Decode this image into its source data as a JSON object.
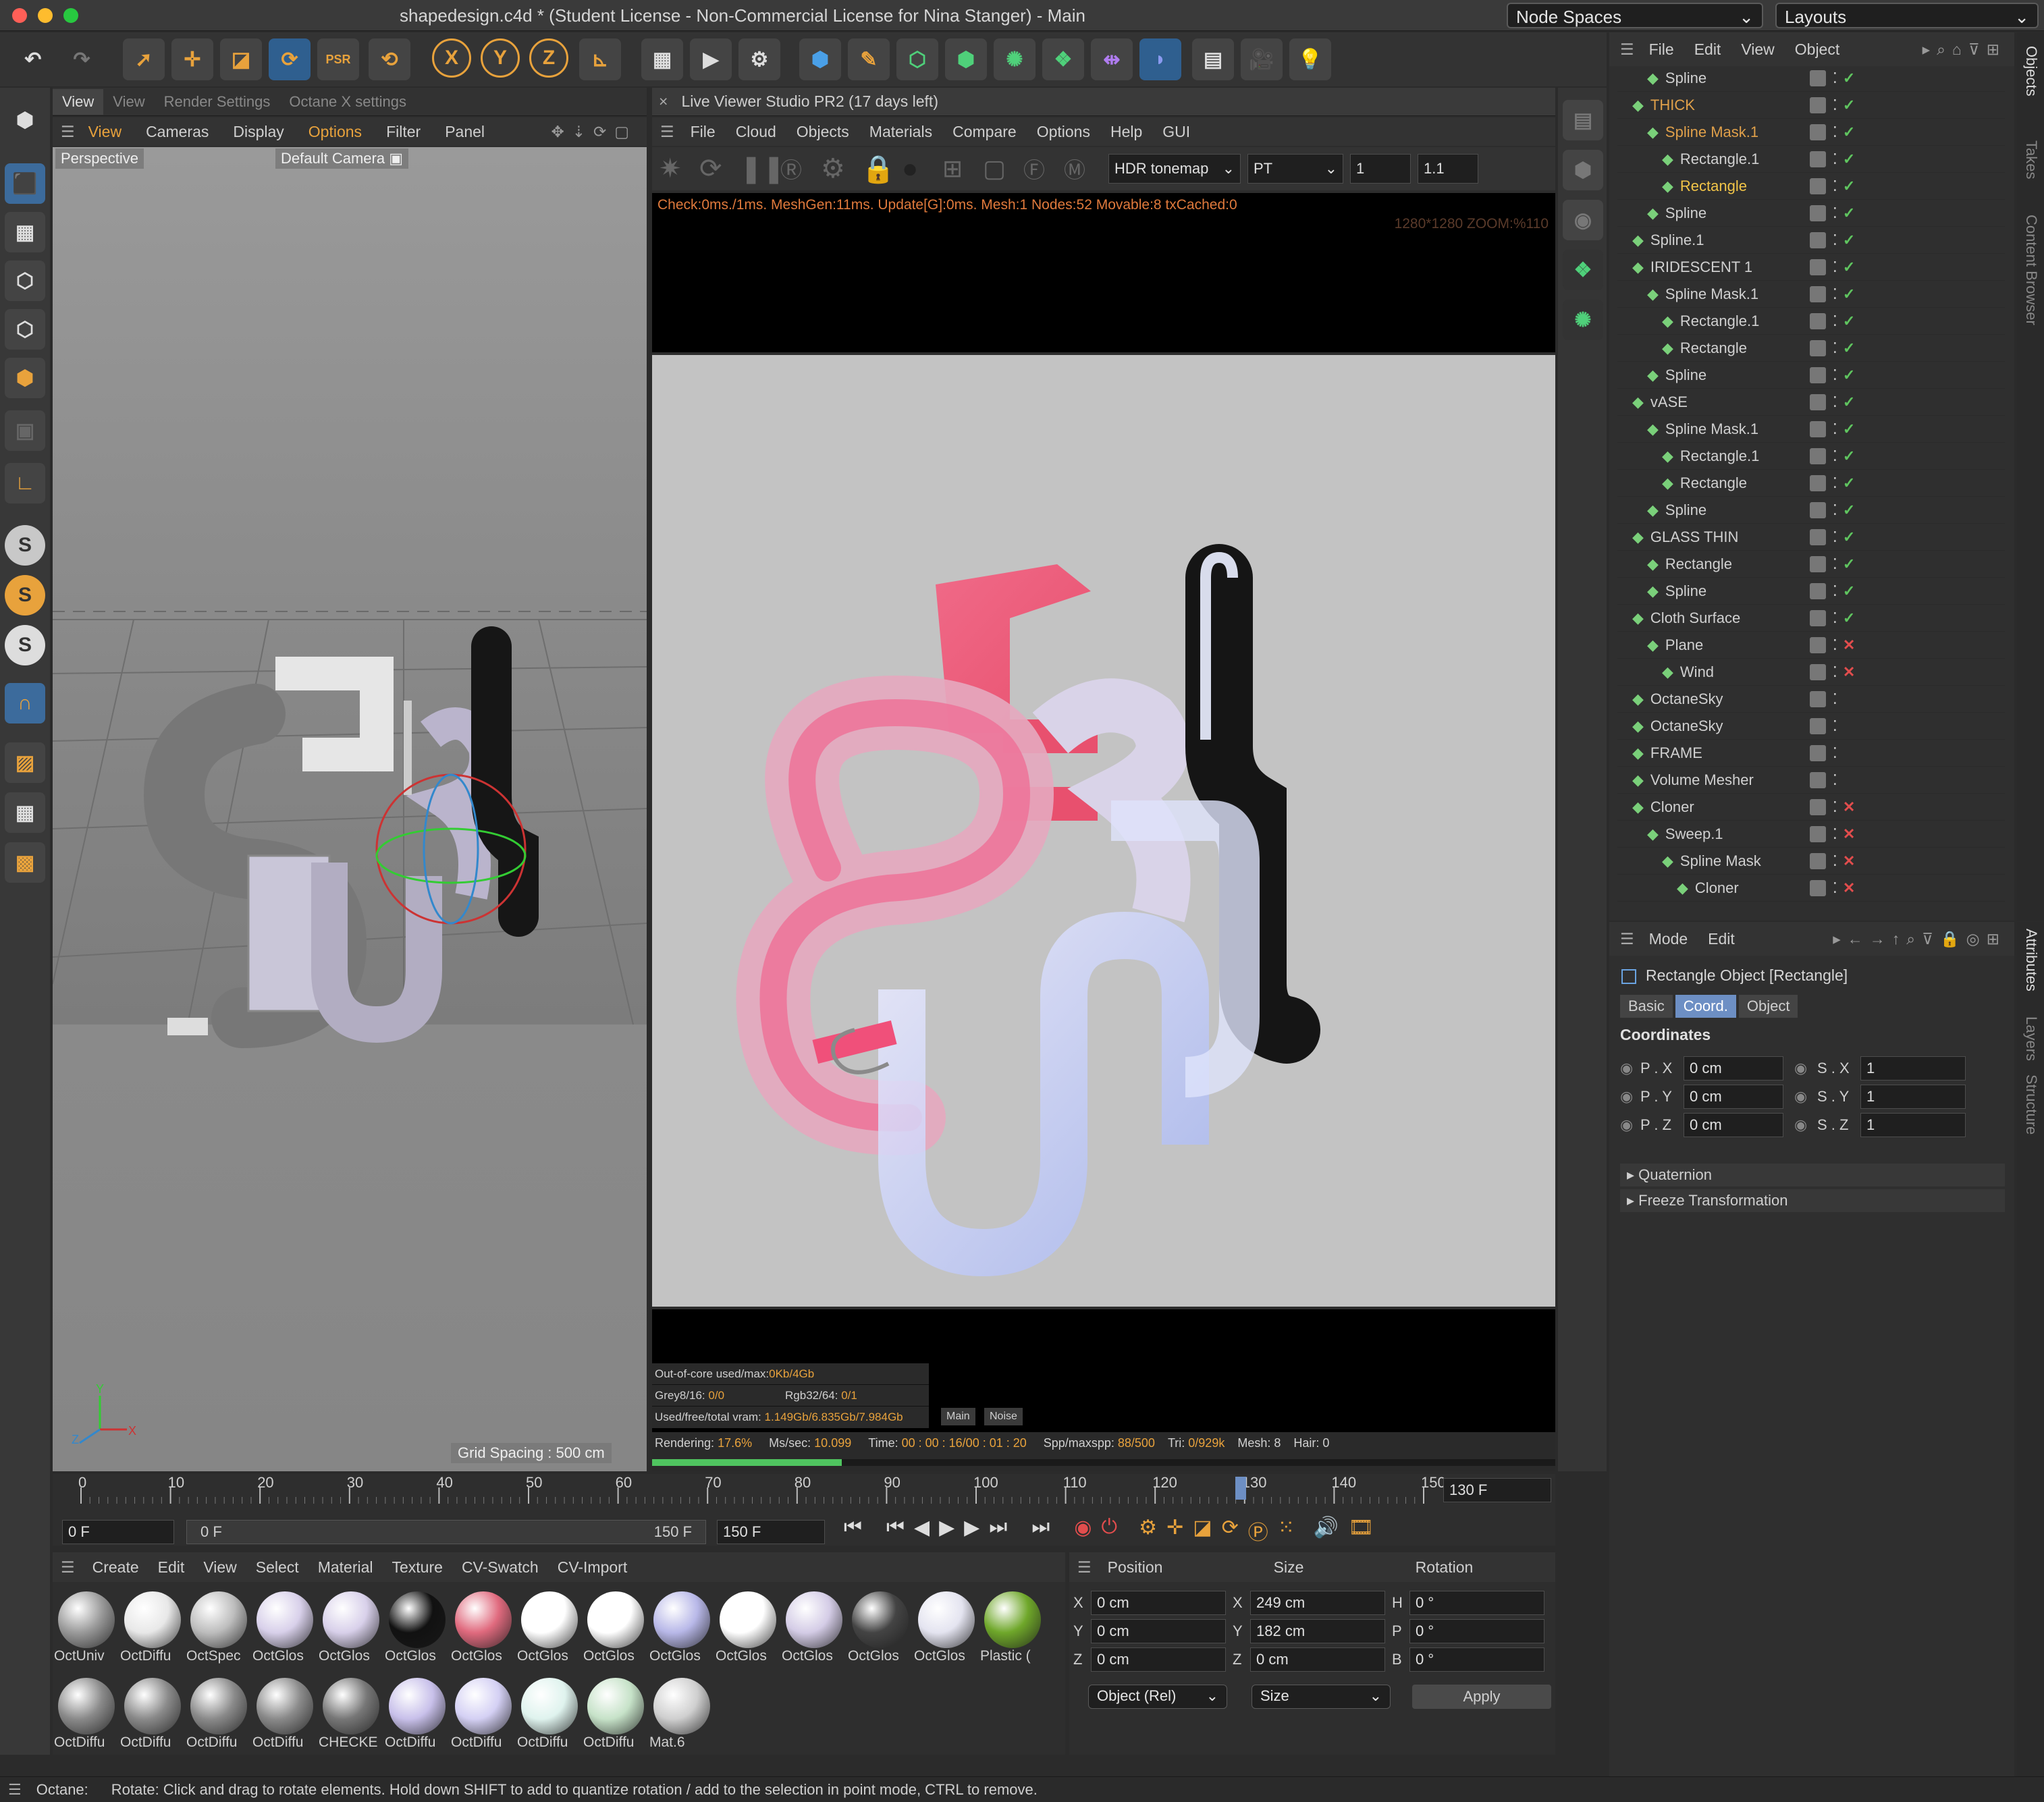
{
  "app": {
    "title": "shapedesign.c4d * (Student License - Non-Commercial License for Nina Stanger) - Main",
    "node_spaces": "Node Spaces",
    "layouts": "Layouts"
  },
  "viewport": {
    "tabs": [
      "View",
      "View",
      "Render Settings",
      "Octane X settings"
    ],
    "menu": [
      "View",
      "Cameras",
      "Display",
      "Options",
      "Filter",
      "Panel"
    ],
    "projection": "Perspective",
    "camera": "Default Camera",
    "grid_spacing": "Grid Spacing : 500 cm",
    "axis_y": "Y",
    "axis_z": "Z",
    "axis_x": "X"
  },
  "live_viewer": {
    "title": "Live Viewer Studio PR2 (17 days left)",
    "menu": [
      "File",
      "Cloud",
      "Objects",
      "Materials",
      "Compare",
      "Options",
      "Help",
      "GUI"
    ],
    "tonemap": "HDR tonemap",
    "kernel": "PT",
    "val1": "1",
    "val2": "1.1",
    "check_line": "Check:0ms./1ms. MeshGen:11ms. Update[G]:0ms. Mesh:1 Nodes:52 Movable:8 txCached:0",
    "zoom": "1280*1280 ZOOM:%110",
    "stats": {
      "ooc_label": "Out-of-core used/max:",
      "ooc_val": "0Kb/4Gb",
      "grey_label": "Grey8/16:",
      "grey_val": "0/0",
      "rgb_label": "Rgb32/64:",
      "rgb_val": "0/1",
      "vram_label": "Used/free/total vram:",
      "vram_val": "1.149Gb/6.835Gb/7.984Gb",
      "tab_main": "Main",
      "tab_noise": "Noise"
    },
    "render": {
      "rendering_label": "Rendering:",
      "rendering_val": "17.6%",
      "ms_label": "Ms/sec:",
      "ms_val": "10.099",
      "time_label": "Time:",
      "time_val": "00 : 00 : 16/00 : 01 : 20",
      "spp_label": "Spp/maxspp:",
      "spp_val": "88/500",
      "tri_label": "Tri:",
      "tri_val": "0/929k",
      "mesh": "Mesh: 8",
      "hair": "Hair: 0",
      "progress": 0.21
    }
  },
  "objects": {
    "menu": [
      "File",
      "Edit",
      "View",
      "Object"
    ],
    "side_tabs": [
      "Objects",
      "Takes",
      "Content Browser"
    ],
    "rows": [
      {
        "name": "Spline",
        "indent": 2,
        "color": "#d0d0d0",
        "status": "tick"
      },
      {
        "name": "THICK",
        "indent": 1,
        "color": "#e0a04a",
        "status": "tick"
      },
      {
        "name": "Spline Mask.1",
        "indent": 2,
        "color": "#e0a04a",
        "status": "tick"
      },
      {
        "name": "Rectangle.1",
        "indent": 3,
        "color": "#d0d0d0",
        "status": "tick"
      },
      {
        "name": "Rectangle",
        "indent": 3,
        "color": "#f2c548",
        "status": "tick"
      },
      {
        "name": "Spline",
        "indent": 2,
        "color": "#d0d0d0",
        "status": "tick"
      },
      {
        "name": "Spline.1",
        "indent": 1,
        "color": "#d0d0d0",
        "status": "tick"
      },
      {
        "name": "IRIDESCENT 1",
        "indent": 1,
        "color": "#d0d0d0",
        "status": "tick"
      },
      {
        "name": "Spline Mask.1",
        "indent": 2,
        "color": "#d0d0d0",
        "status": "tick"
      },
      {
        "name": "Rectangle.1",
        "indent": 3,
        "color": "#d0d0d0",
        "status": "tick"
      },
      {
        "name": "Rectangle",
        "indent": 3,
        "color": "#d0d0d0",
        "status": "tick"
      },
      {
        "name": "Spline",
        "indent": 2,
        "color": "#d0d0d0",
        "status": "tick"
      },
      {
        "name": "vASE",
        "indent": 1,
        "color": "#d0d0d0",
        "status": "tick"
      },
      {
        "name": "Spline Mask.1",
        "indent": 2,
        "color": "#d0d0d0",
        "status": "tick"
      },
      {
        "name": "Rectangle.1",
        "indent": 3,
        "color": "#d0d0d0",
        "status": "tick"
      },
      {
        "name": "Rectangle",
        "indent": 3,
        "color": "#d0d0d0",
        "status": "tick"
      },
      {
        "name": "Spline",
        "indent": 2,
        "color": "#d0d0d0",
        "status": "tick"
      },
      {
        "name": "GLASS THIN",
        "indent": 1,
        "color": "#d0d0d0",
        "status": "tick"
      },
      {
        "name": "Rectangle",
        "indent": 2,
        "color": "#d0d0d0",
        "status": "tick"
      },
      {
        "name": "Spline",
        "indent": 2,
        "color": "#d0d0d0",
        "status": "tick"
      },
      {
        "name": "Cloth Surface",
        "indent": 1,
        "color": "#d0d0d0",
        "status": "tick"
      },
      {
        "name": "Plane",
        "indent": 2,
        "color": "#d0d0d0",
        "status": "cross"
      },
      {
        "name": "Wind",
        "indent": 3,
        "color": "#d0d0d0",
        "status": "cross"
      },
      {
        "name": "OctaneSky",
        "indent": 1,
        "color": "#d0d0d0",
        "status": "none"
      },
      {
        "name": "OctaneSky",
        "indent": 1,
        "color": "#d0d0d0",
        "status": "none"
      },
      {
        "name": "FRAME",
        "indent": 1,
        "color": "#d0d0d0",
        "status": "none"
      },
      {
        "name": "Volume Mesher",
        "indent": 1,
        "color": "#d0d0d0",
        "status": "none"
      },
      {
        "name": "Cloner",
        "indent": 1,
        "color": "#d0d0d0",
        "status": "cross"
      },
      {
        "name": "Sweep.1",
        "indent": 2,
        "color": "#d0d0d0",
        "status": "cross"
      },
      {
        "name": "Spline Mask",
        "indent": 3,
        "color": "#d0d0d0",
        "status": "cross"
      },
      {
        "name": "Cloner",
        "indent": 4,
        "color": "#d0d0d0",
        "status": "cross"
      }
    ]
  },
  "attributes": {
    "menu": [
      "Mode",
      "Edit"
    ],
    "side_tabs": [
      "Attributes",
      "Layers",
      "Structure"
    ],
    "object_title": "Rectangle Object [Rectangle]",
    "tabs": [
      "Basic",
      "Coord.",
      "Object"
    ],
    "section": "Coordinates",
    "px_label": "P . X",
    "px": "0 cm",
    "py_label": "P . Y",
    "py": "0 cm",
    "pz_label": "P . Z",
    "pz": "0 cm",
    "sx_label": "S . X",
    "sx": "1",
    "sy_label": "S . Y",
    "sy": "1",
    "sz_label": "S . Z",
    "sz": "1",
    "quaternion": "Quaternion",
    "freeze": "Freeze Transformation"
  },
  "timeline": {
    "ticks": [
      "0",
      "10",
      "20",
      "30",
      "40",
      "50",
      "60",
      "70",
      "80",
      "90",
      "100",
      "110",
      "120",
      "130",
      "140",
      "150"
    ],
    "current": "130 F",
    "start": "0 F",
    "min": "0 F",
    "max": "150 F",
    "end": "150 F"
  },
  "materials": {
    "menu": [
      "Create",
      "Edit",
      "View",
      "Select",
      "Material",
      "Texture",
      "CV-Swatch",
      "CV-Import"
    ],
    "row1": [
      {
        "label": "OctUniv",
        "color": "#9a9a9a"
      },
      {
        "label": "OctDiffu",
        "color": "#e8e8e8"
      },
      {
        "label": "OctSpec",
        "color": "#bdbdbd"
      },
      {
        "label": "OctGlos",
        "color": "#d8d0ea"
      },
      {
        "label": "OctGlos",
        "color": "#d8d0ea"
      },
      {
        "label": "OctGlos",
        "color": "#111111"
      },
      {
        "label": "OctGlos",
        "color": "#e06a7e"
      },
      {
        "label": "OctGlos",
        "color": "#ffffff"
      },
      {
        "label": "OctGlos",
        "color": "#ffffff"
      },
      {
        "label": "OctGlos",
        "color": "#b8b8e8"
      },
      {
        "label": "OctGlos",
        "color": "#ffffff"
      },
      {
        "label": "OctGlos",
        "color": "#d4cce6"
      },
      {
        "label": "OctGlos",
        "color": "#444444"
      },
      {
        "label": "OctGlos",
        "color": "#e4e4f0"
      },
      {
        "label": "Plastic (",
        "color": "#6fa72a"
      }
    ],
    "row2": [
      {
        "label": "OctDiffu",
        "color": "#8a8a8a"
      },
      {
        "label": "OctDiffu",
        "color": "#8a8a8a"
      },
      {
        "label": "OctDiffu",
        "color": "#8a8a8a"
      },
      {
        "label": "OctDiffu",
        "color": "#8a8a8a"
      },
      {
        "label": "CHECKE",
        "color": "#777777"
      },
      {
        "label": "OctDiffu",
        "color": "#c8c0ea"
      },
      {
        "label": "OctDiffu",
        "color": "#d4d0f4"
      },
      {
        "label": "OctDiffu",
        "color": "#dff3ee"
      },
      {
        "label": "OctDiffu",
        "color": "#c6e2c8"
      },
      {
        "label": "Mat.6",
        "color": "#cfcfcf"
      }
    ]
  },
  "coords": {
    "position": "Position",
    "size": "Size",
    "rotation": "Rotation",
    "x": "0 cm",
    "y": "0 cm",
    "z": "0 cm",
    "sx": "249 cm",
    "sy": "182 cm",
    "sz": "0 cm",
    "h": "0 °",
    "p": "0 °",
    "b": "0 °",
    "x_label": "X",
    "y_label": "Y",
    "z_label": "Z",
    "h_label": "H",
    "p_label": "P",
    "b_label": "B",
    "mode": "Object (Rel)",
    "size_mode": "Size",
    "apply": "Apply"
  },
  "status": {
    "prefix": "Octane:",
    "text": "Rotate: Click and drag to rotate elements. Hold down SHIFT to add to quantize rotation / add to the selection in point mode, CTRL to remove."
  }
}
